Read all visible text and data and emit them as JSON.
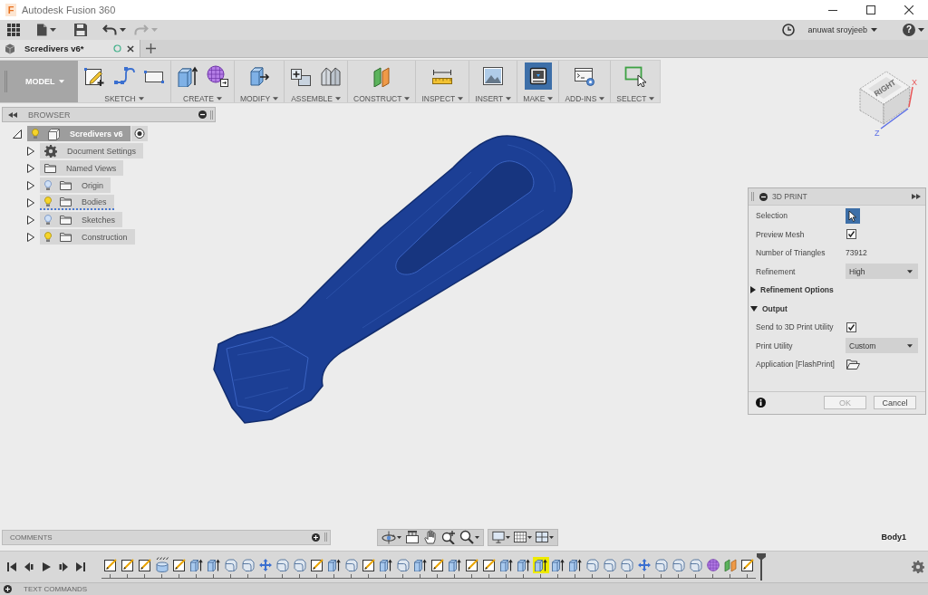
{
  "window": {
    "logo": "F",
    "title": "Autodesk Fusion 360"
  },
  "quick_access": {
    "history": [
      {
        "kind": "undo",
        "disabled": false
      },
      {
        "kind": "redo",
        "disabled": true
      }
    ],
    "user": "anuwat sroyjeeb",
    "help": "?"
  },
  "document_tabs": [
    {
      "label": "Scredivers v6*",
      "selected": true
    }
  ],
  "toolbar": {
    "workspace": "MODEL",
    "groups": [
      {
        "label": "SKETCH",
        "tools": [
          {
            "kind": "sketch",
            "selected": false
          },
          {
            "kind": "spline",
            "selected": false
          },
          {
            "kind": "rectangle",
            "selected": false
          }
        ]
      },
      {
        "label": "CREATE",
        "tools": [
          {
            "kind": "extrude",
            "selected": false
          },
          {
            "kind": "form",
            "selected": false
          }
        ]
      },
      {
        "label": "MODIFY",
        "tools": [
          {
            "kind": "press",
            "selected": false
          }
        ]
      },
      {
        "label": "ASSEMBLE",
        "tools": [
          {
            "kind": "component",
            "selected": false
          },
          {
            "kind": "joint",
            "selected": false
          }
        ]
      },
      {
        "label": "CONSTRUCT",
        "tools": [
          {
            "kind": "plane",
            "selected": false
          }
        ]
      },
      {
        "label": "INSPECT",
        "tools": [
          {
            "kind": "measure",
            "selected": false
          }
        ]
      },
      {
        "label": "INSERT",
        "tools": [
          {
            "kind": "image",
            "selected": false
          }
        ]
      },
      {
        "label": "MAKE",
        "tools": [
          {
            "kind": "print",
            "selected": true
          }
        ]
      },
      {
        "label": "ADD-INS",
        "tools": [
          {
            "kind": "script",
            "selected": false
          }
        ]
      },
      {
        "label": "SELECT",
        "tools": [
          {
            "kind": "select",
            "selected": false
          }
        ]
      }
    ]
  },
  "browser": {
    "title": "BROWSER",
    "tree": [
      {
        "label": "Scredivers v6",
        "kind": "component",
        "visible": true,
        "expanded": true,
        "active": true,
        "children": [
          {
            "label": "Document Settings",
            "kind": "settings",
            "expanded": false,
            "active": false
          },
          {
            "label": "Named Views",
            "kind": "folder",
            "expanded": false,
            "active": false
          },
          {
            "label": "Origin",
            "kind": "folder",
            "visible": false,
            "expanded": false,
            "active": false,
            "flagged": false
          },
          {
            "label": "Bodies",
            "kind": "folder",
            "visible": true,
            "expanded": false,
            "active": false,
            "flagged": true
          },
          {
            "label": "Sketches",
            "kind": "folder",
            "visible": false,
            "expanded": false,
            "active": false,
            "flagged": false
          },
          {
            "label": "Construction",
            "kind": "folder",
            "visible": true,
            "expanded": false,
            "active": false,
            "flagged": false
          }
        ]
      }
    ]
  },
  "view_cube": {
    "face": "RIGHT",
    "axes": [
      {
        "label": "X",
        "color": "#e8585a"
      },
      {
        "label": "Z",
        "color": "#5b6ee6"
      }
    ]
  },
  "print_panel": {
    "title": "3D PRINT",
    "rows": [
      {
        "kind": "selection",
        "label": "Selection",
        "selected": true
      },
      {
        "kind": "checkbox",
        "label": "Preview Mesh",
        "checked": true
      },
      {
        "kind": "value",
        "label": "Number of Triangles",
        "value": "73912"
      },
      {
        "kind": "dropdown",
        "label": "Refinement",
        "value": "High"
      },
      {
        "kind": "section",
        "label": "Refinement Options",
        "expanded": false
      },
      {
        "kind": "section",
        "label": "Output",
        "expanded": true
      },
      {
        "kind": "checkbox",
        "label": "Send to 3D Print Utility",
        "checked": true
      },
      {
        "kind": "dropdown",
        "label": "Print Utility",
        "value": "Custom"
      },
      {
        "kind": "browse",
        "label": "Application [FlashPrint]"
      }
    ],
    "buttons": [
      {
        "label": "OK",
        "disabled": true
      },
      {
        "label": "Cancel",
        "disabled": false
      }
    ]
  },
  "comments": {
    "title": "COMMENTS"
  },
  "selection_label": "Body1",
  "timeline": {
    "items": [
      {
        "kind": "sketch",
        "selected": false
      },
      {
        "kind": "sketch",
        "selected": false
      },
      {
        "kind": "sketch",
        "selected": false
      },
      {
        "kind": "cylinder",
        "selected": false
      },
      {
        "kind": "sketch",
        "selected": false
      },
      {
        "kind": "extrude",
        "selected": false
      },
      {
        "kind": "extrude",
        "selected": false
      },
      {
        "kind": "fillet",
        "selected": false
      },
      {
        "kind": "fillet",
        "selected": false
      },
      {
        "kind": "move",
        "selected": false
      },
      {
        "kind": "fillet",
        "selected": false
      },
      {
        "kind": "fillet",
        "selected": false
      },
      {
        "kind": "sketch",
        "selected": false
      },
      {
        "kind": "extrude",
        "selected": false
      },
      {
        "kind": "fillet",
        "selected": false
      },
      {
        "kind": "sketch",
        "selected": false
      },
      {
        "kind": "extrude",
        "selected": false
      },
      {
        "kind": "fillet",
        "selected": false
      },
      {
        "kind": "extrude",
        "selected": false
      },
      {
        "kind": "sketch",
        "selected": false
      },
      {
        "kind": "extrude",
        "selected": false
      },
      {
        "kind": "sketch",
        "selected": false
      },
      {
        "kind": "sketch",
        "selected": false
      },
      {
        "kind": "extrude",
        "selected": false
      },
      {
        "kind": "extrude",
        "selected": false
      },
      {
        "kind": "extrude",
        "selected": true
      },
      {
        "kind": "extrude",
        "selected": false
      },
      {
        "kind": "extrude",
        "selected": false
      },
      {
        "kind": "fillet",
        "selected": false
      },
      {
        "kind": "fillet",
        "selected": false
      },
      {
        "kind": "fillet",
        "selected": false
      },
      {
        "kind": "move",
        "selected": false
      },
      {
        "kind": "fillet",
        "selected": false
      },
      {
        "kind": "fillet",
        "selected": false
      },
      {
        "kind": "fillet",
        "selected": false
      },
      {
        "kind": "form",
        "selected": false
      },
      {
        "kind": "plane",
        "selected": false
      },
      {
        "kind": "sketch",
        "selected": false
      }
    ]
  },
  "text_commands": {
    "title": "TEXT COMMANDS"
  }
}
